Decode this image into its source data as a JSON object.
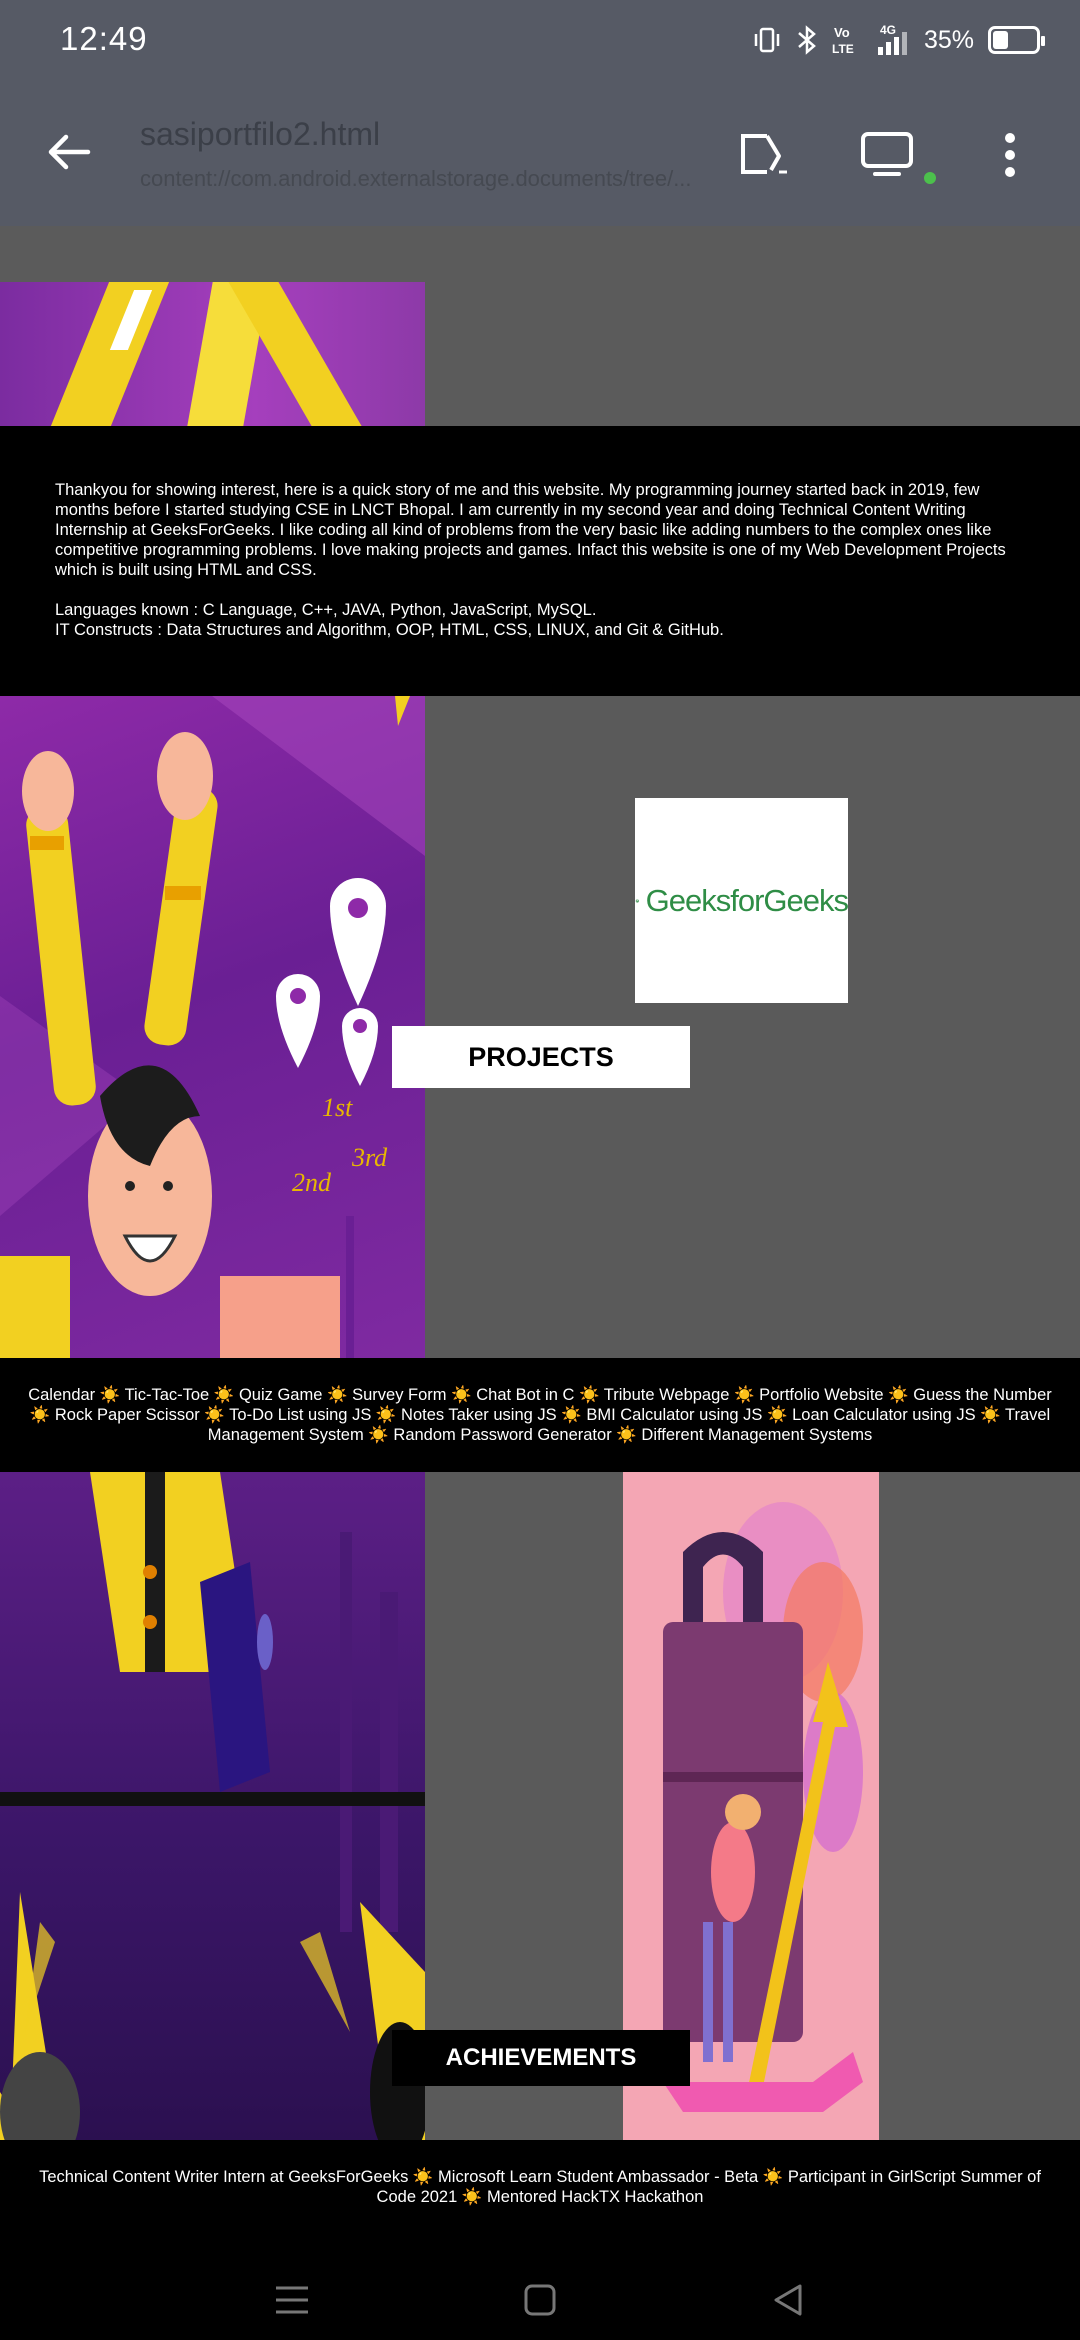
{
  "status_bar": {
    "time": "12:49",
    "battery_percent": "35%",
    "battery_level": 0.35,
    "network_label": "4G",
    "volte_label": "Vo LTE",
    "icons": [
      "vibrate-icon",
      "bluetooth-icon",
      "volte-icon",
      "signal-icon",
      "battery-icon"
    ]
  },
  "app_bar": {
    "title": "sasiportfilo2.html",
    "path": "content://com.android.externalstorage.documents/tree/...",
    "icons": [
      "back-arrow-icon",
      "cast-icon",
      "desktop-mode-icon",
      "more-vert-icon"
    ],
    "status_dot_color": "#4cc04c"
  },
  "about": {
    "story": "Thankyou for showing interest, here is a quick story of me and this website. My programming journey started back in 2019, few months before I started studying CSE in LNCT Bhopal. I am currently in my second year and doing Technical Content Writing Internship at GeeksForGeeks. I like coding all kind of problems from the very basic like adding numbers to the complex ones like competitive programming problems. I love making projects and games. Infact this website is one of my Web Development Projects which is built using HTML and CSS.",
    "languages": "Languages known : C Language, C++, JAVA, Python, JavaScript, MySQL.",
    "constructs": "IT Constructs : Data Structures and Algorithm, OOP, HTML, CSS, LINUX, and Git & GitHub."
  },
  "projects": {
    "heading": "PROJECTS",
    "logo_text": "GeeksforGeeks",
    "list": "Calendar ☀️ Tic-Tac-Toe ☀️ Quiz Game ☀️ Survey Form ☀️ Chat Bot in C ☀️ Tribute Webpage ☀️ Portfolio Website ☀️ Guess the Number ☀️ Rock Paper Scissor ☀️ To-Do List using JS ☀️ Notes Taker using JS ☀️ BMI Calculator using JS ☀️ Loan Calculator using JS ☀️ Travel Management System ☀️ Random Password Generator ☀️ Different Management Systems",
    "podium_labels": [
      "2nd",
      "1st",
      "3rd"
    ]
  },
  "achievements": {
    "heading": "ACHIEVEMENTS",
    "list": "Technical Content Writer Intern at GeeksForGeeks ☀️ Microsoft Learn Student Ambassador - Beta ☀️ Participant in GirlScript Summer of Code 2021 ☀️ Mentored HackTX Hackathon"
  },
  "nav_bar": {
    "icons": [
      "recents-menu-icon",
      "home-square-icon",
      "back-triangle-icon"
    ]
  },
  "colors": {
    "chrome": "#565a65",
    "page_bg": "#5a5a5a",
    "purple": "#7b2ca0",
    "yellow": "#f2d021",
    "gfg_green": "#2f8d46",
    "pink": "#f4a6b4"
  }
}
